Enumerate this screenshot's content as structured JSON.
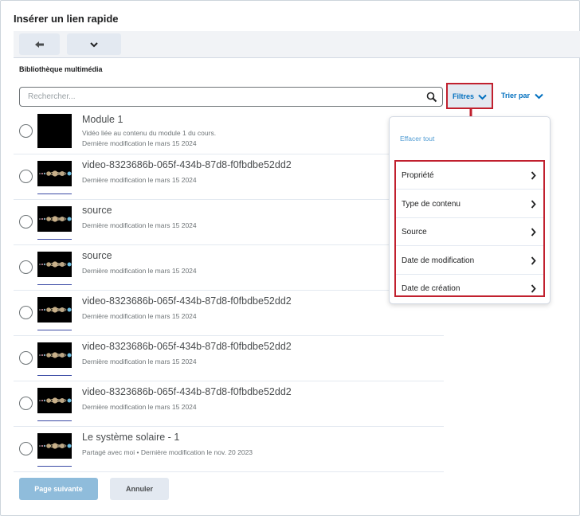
{
  "dialog": {
    "title": "Insérer un lien rapide"
  },
  "toolbar": {
    "back_icon": "arrow-left-icon",
    "menu_icon": "chevron-down-icon"
  },
  "library": {
    "label": "Bibliothèque multimédia",
    "search_placeholder": "Rechercher...",
    "search_icon": "search-icon",
    "filters_label": "Filtres",
    "sort_label": "Trier par"
  },
  "items": [
    {
      "name": "Module 1",
      "description": "Vidéo liée au contenu du module 1 du cours.",
      "meta": "Dernière modification le mars 15 2024",
      "thumb": "black"
    },
    {
      "name": "video-8323686b-065f-434b-87d8-f0fbdbe52dd2",
      "meta": "Dernière modification le mars 15 2024",
      "thumb": "planets"
    },
    {
      "name": "source",
      "meta": "Dernière modification le mars 15 2024",
      "thumb": "planets"
    },
    {
      "name": "source",
      "meta": "Dernière modification le mars 15 2024",
      "thumb": "planets"
    },
    {
      "name": "video-8323686b-065f-434b-87d8-f0fbdbe52dd2",
      "meta": "Dernière modification le mars 15 2024",
      "thumb": "planets"
    },
    {
      "name": "video-8323686b-065f-434b-87d8-f0fbdbe52dd2",
      "meta": "Dernière modification le mars 15 2024",
      "thumb": "planets"
    },
    {
      "name": "video-8323686b-065f-434b-87d8-f0fbdbe52dd2",
      "meta": "Dernière modification le mars 15 2024",
      "thumb": "planets"
    },
    {
      "name": "Le système solaire - 1",
      "meta": "Partagé avec moi • Dernière modification le nov. 20 2023",
      "thumb": "planets"
    }
  ],
  "filters_menu": {
    "clear_all": "Effacer tout",
    "options": [
      "Propriété",
      "Type de contenu",
      "Source",
      "Date de modification",
      "Date de création"
    ]
  },
  "footer": {
    "next_label": "Page suivante",
    "cancel_label": "Annuler"
  },
  "colors": {
    "accent": "#006fbf",
    "highlight": "#c1202e"
  }
}
